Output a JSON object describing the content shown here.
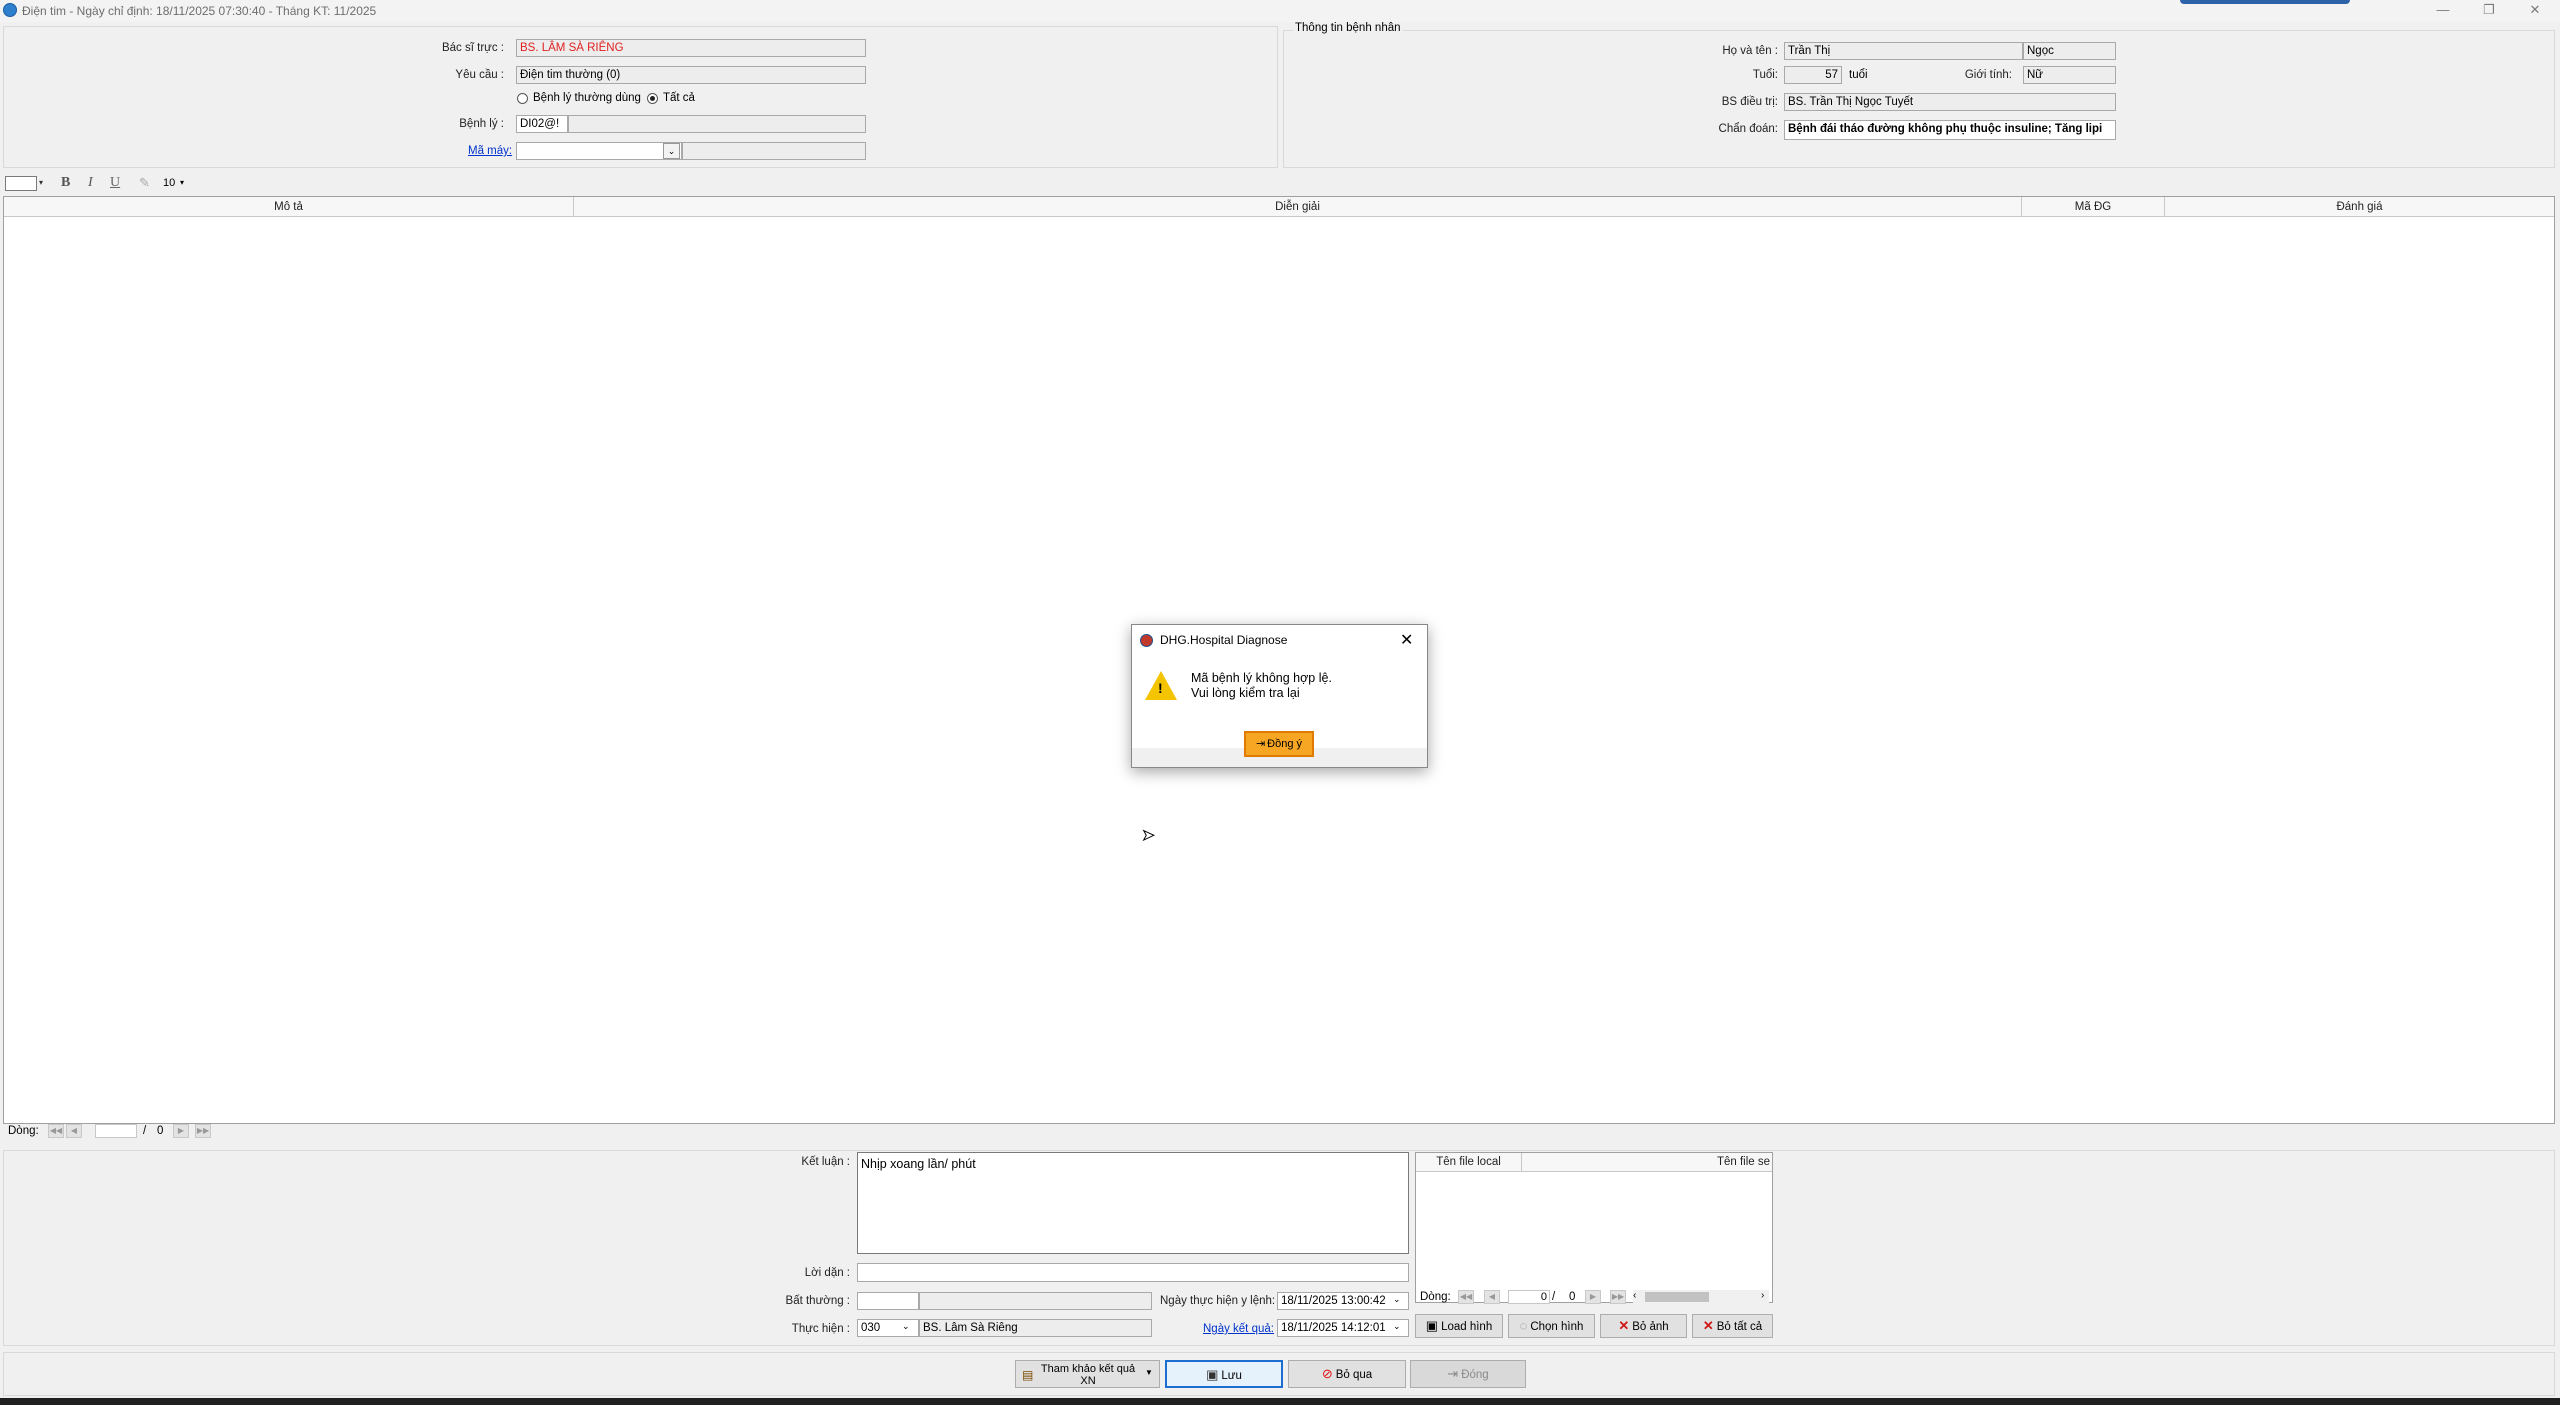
{
  "window": {
    "title": "Điện tim - Ngày chỉ định: 18/11/2025 07:30:40 - Tháng KT: 11/2025",
    "minimize": "—",
    "restore": "❐",
    "close": "✕"
  },
  "order_panel": {
    "bac_si_truc_label": "Bác sĩ trực :",
    "bac_si_truc_value": "BS. LÂM SÀ RIÊNG",
    "yeu_cau_label": "Yêu cầu :",
    "yeu_cau_value": "Điện tim thường (0)",
    "radio_common": "Bệnh lý thường dùng",
    "radio_all": "Tất cả",
    "benh_ly_label": "Bệnh lý :",
    "benh_ly_value": "DI02@!",
    "ma_may_label": "Mã máy:"
  },
  "patient_panel": {
    "group_title": "Thông tin bệnh nhân",
    "ho_ten_label": "Họ và tên :",
    "ho_ten_value": "Trần Thị",
    "ten_value": "Ngọc",
    "tuoi_label": "Tuổi:",
    "tuoi_value": "57",
    "tuoi_unit": "tuổi",
    "gioi_tinh_label": "Giới tính:",
    "gioi_tinh_value": "Nữ",
    "bs_dieu_tri_label": "BS điều trị:",
    "bs_dieu_tri_value": "BS. Trần Thị Ngọc Tuyết",
    "chan_doan_label": "Chẩn đoán:",
    "chan_doan_value": "Bệnh đái tháo đường không phụ thuộc insuline; Tăng lipi"
  },
  "format_toolbar": {
    "bold": "B",
    "italic": "I",
    "underline": "U",
    "font_size": "10"
  },
  "grid": {
    "columns": [
      "Mô tả",
      "Diễn giải",
      "Mã ĐG",
      "Đánh giá"
    ],
    "nav_label": "Dòng:",
    "nav_sep": "/",
    "nav_total": "0"
  },
  "result_panel": {
    "ket_luan_label": "Kết luận :",
    "ket_luan_value": "Nhịp xoang lần/ phút",
    "loi_dan_label": "Lời dặn :",
    "bat_thuong_label": "Bất thường :",
    "thuc_hien_label": "Thực hiện :",
    "thuc_hien_code": "030",
    "thuc_hien_name": "BS. Lâm Sà Riêng",
    "ngay_thuc_hien_label": "Ngày thực hiện y lệnh:",
    "ngay_thuc_hien_value": "18/11/2025 13:00:42",
    "ngay_ket_qua_label": "Ngày kết quả:",
    "ngay_ket_qua_value": "18/11/2025 14:12:01"
  },
  "file_panel": {
    "col_local": "Tên file local",
    "col_server": "Tên file se",
    "nav_label": "Dòng:",
    "nav_current": "0",
    "nav_sep": "/",
    "nav_total": "0",
    "load_image": "Load hình",
    "choose_image": "Chọn hình",
    "remove_image": "Bỏ ảnh",
    "remove_all": "Bỏ tất cả"
  },
  "bottom_bar": {
    "tham_khao": "Tham khảo kết quả XN",
    "luu": "Lưu",
    "bo_qua": "Bỏ qua",
    "dong": "Đóng"
  },
  "dialog": {
    "title": "DHG.Hospital Diagnose",
    "message_line1": "Mã bệnh lý không hợp lệ.",
    "message_line2": "Vui lòng kiểm tra lại",
    "ok_button": "Đồng ý"
  },
  "colors": {
    "accent_blue": "#0033cc",
    "doctor_red": "#e02020",
    "ok_button_bg": "#f6a623",
    "warning_yellow": "#f5c400"
  },
  "icons": [
    "app-icon",
    "warning-icon",
    "door-exit-icon",
    "save-icon",
    "cancel-icon",
    "close-x-icon",
    "image-icon"
  ]
}
